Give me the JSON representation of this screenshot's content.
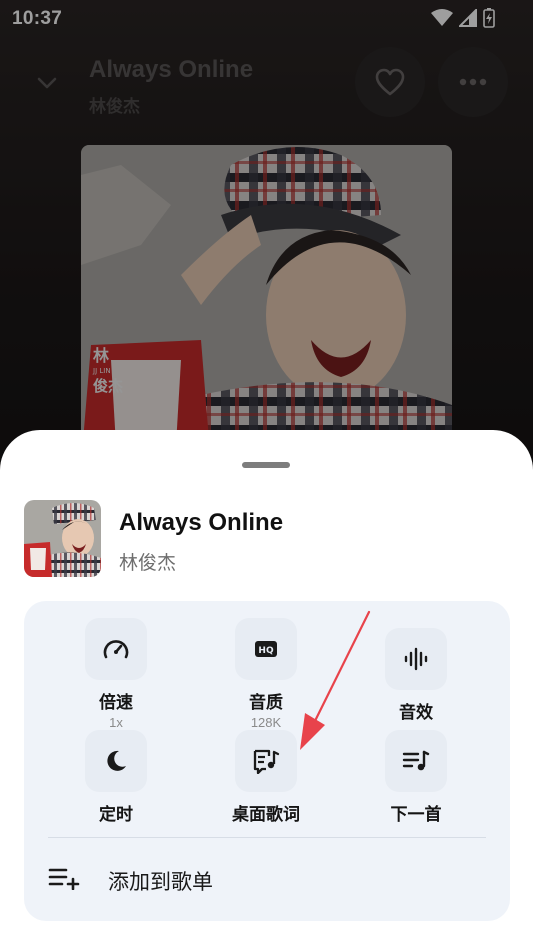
{
  "status_bar": {
    "time": "10:37"
  },
  "player": {
    "title": "Always Online",
    "artist": "林俊杰",
    "cover_text": {
      "line1": "林",
      "line2": "JJ LIN",
      "line3": "俊杰"
    }
  },
  "sheet": {
    "song": {
      "title": "Always Online",
      "artist": "林俊杰"
    },
    "actions": [
      {
        "label": "倍速",
        "sub": "1x",
        "icon": "speed-gauge-icon"
      },
      {
        "label": "音质",
        "sub": "128K",
        "icon": "hq-icon"
      },
      {
        "label": "音效",
        "sub": "",
        "icon": "sound-wave-icon"
      },
      {
        "label": "定时",
        "sub": "",
        "icon": "moon-icon"
      },
      {
        "label": "桌面歌词",
        "sub": "",
        "icon": "lyrics-icon"
      },
      {
        "label": "下一首",
        "sub": "",
        "icon": "play-next-icon"
      }
    ],
    "add_to_playlist": {
      "label": "添加到歌单",
      "icon": "playlist-add-icon"
    }
  },
  "colors": {
    "sheet_bg": "#ffffff",
    "panel_bg": "#eff3f9",
    "annotation_arrow": "#e8434b"
  }
}
